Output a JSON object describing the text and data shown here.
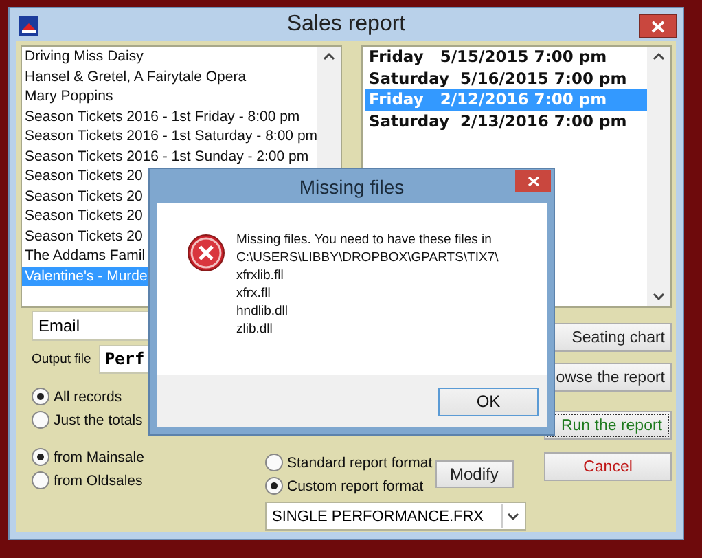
{
  "window": {
    "title": "Sales report"
  },
  "shows": {
    "items": [
      {
        "label": "Driving Miss Daisy",
        "selected": false
      },
      {
        "label": "Hansel & Gretel, A Fairytale Opera",
        "selected": false
      },
      {
        "label": "Mary Poppins",
        "selected": false
      },
      {
        "label": "Season Tickets 2016 - 1st Friday - 8:00 pm",
        "selected": false
      },
      {
        "label": "Season Tickets 2016 - 1st Saturday - 8:00 pm",
        "selected": false
      },
      {
        "label": "Season Tickets 2016 - 1st Sunday - 2:00 pm",
        "selected": false
      },
      {
        "label": "Season Tickets 20",
        "selected": false
      },
      {
        "label": "Season Tickets 20",
        "selected": false
      },
      {
        "label": "Season Tickets 20",
        "selected": false
      },
      {
        "label": "Season Tickets 20",
        "selected": false
      },
      {
        "label": "The Addams Famil",
        "selected": false
      },
      {
        "label": "Valentine's - Murde",
        "selected": true
      }
    ]
  },
  "performances": {
    "items": [
      {
        "label": "Friday   5/15/2015 7:00 pm",
        "selected": false
      },
      {
        "label": "Saturday  5/16/2015 7:00 pm",
        "selected": false
      },
      {
        "label": "Friday   2/12/2016 7:00 pm",
        "selected": true
      },
      {
        "label": "Saturday  2/13/2016 7:00 pm",
        "selected": false
      }
    ]
  },
  "output_type": {
    "value": "Email"
  },
  "output_file": {
    "label": "Output file",
    "value": "Perf"
  },
  "detail_options": [
    {
      "label": "All records",
      "selected": true
    },
    {
      "label": "Just the totals",
      "selected": false
    }
  ],
  "source_options": [
    {
      "label": "from Mainsale",
      "selected": true
    },
    {
      "label": "from Oldsales",
      "selected": false
    }
  ],
  "format_options": [
    {
      "label": "Standard report format",
      "selected": false
    },
    {
      "label": "Custom report format",
      "selected": true
    }
  ],
  "modify_button": "Modify",
  "format_file": {
    "value": "SINGLE PERFORMANCE.FRX"
  },
  "buttons": [
    {
      "label": "Seating chart",
      "kind": "normal"
    },
    {
      "label": "owse the report",
      "kind": "normal"
    },
    {
      "label": "Run the report",
      "kind": "default"
    },
    {
      "label": "Cancel",
      "kind": "cancel"
    }
  ],
  "dialog": {
    "title": "Missing files",
    "message": "Missing files. You need to have these files in\nC:\\USERS\\LIBBY\\DROPBOX\\GPARTS\\TIX7\\\nxfrxlib.fll\nxfrx.fll\nhndlib.dll\nzlib.dll",
    "button": "OK"
  }
}
